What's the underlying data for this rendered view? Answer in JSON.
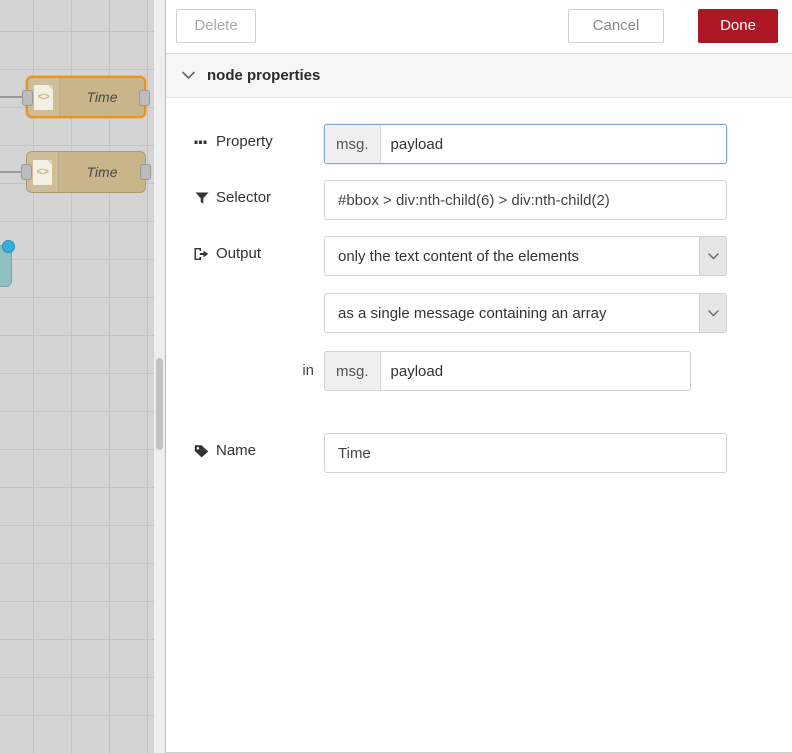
{
  "canvas": {
    "nodes": [
      {
        "label": "Time",
        "icon": "code-document-icon",
        "selected": true
      },
      {
        "label": "Time",
        "icon": "code-document-icon",
        "selected": false
      }
    ],
    "code_glyph": "<>",
    "node_color": "#c8b68a",
    "selected_border_color": "#e8921f",
    "grid_color": "#c3c3c3",
    "background_color": "#d4d4d4",
    "partial_node": {
      "status_color": "#32b0e0",
      "color": "#8fc0c0"
    }
  },
  "panel": {
    "buttons": {
      "delete": "Delete",
      "cancel": "Cancel",
      "done": "Done"
    },
    "done_color": "#ad1625",
    "section": {
      "title": "node properties",
      "chevron": "⌄"
    },
    "form": {
      "property": {
        "label": "Property",
        "icon": "ellipsis-icon",
        "prefix": "msg.",
        "value": "payload",
        "focused": true
      },
      "selector": {
        "label": "Selector",
        "icon": "filter-icon",
        "value": "#bbox > div:nth-child(6) > div:nth-child(2)"
      },
      "output": {
        "label": "Output",
        "icon": "sign-out-icon",
        "select_one": "only the text content of the elements",
        "select_two": "as a single message containing an array",
        "in_word": "in",
        "target_prefix": "msg.",
        "target_value": "payload"
      },
      "name": {
        "label": "Name",
        "icon": "tag-icon",
        "value": "Time"
      }
    }
  }
}
